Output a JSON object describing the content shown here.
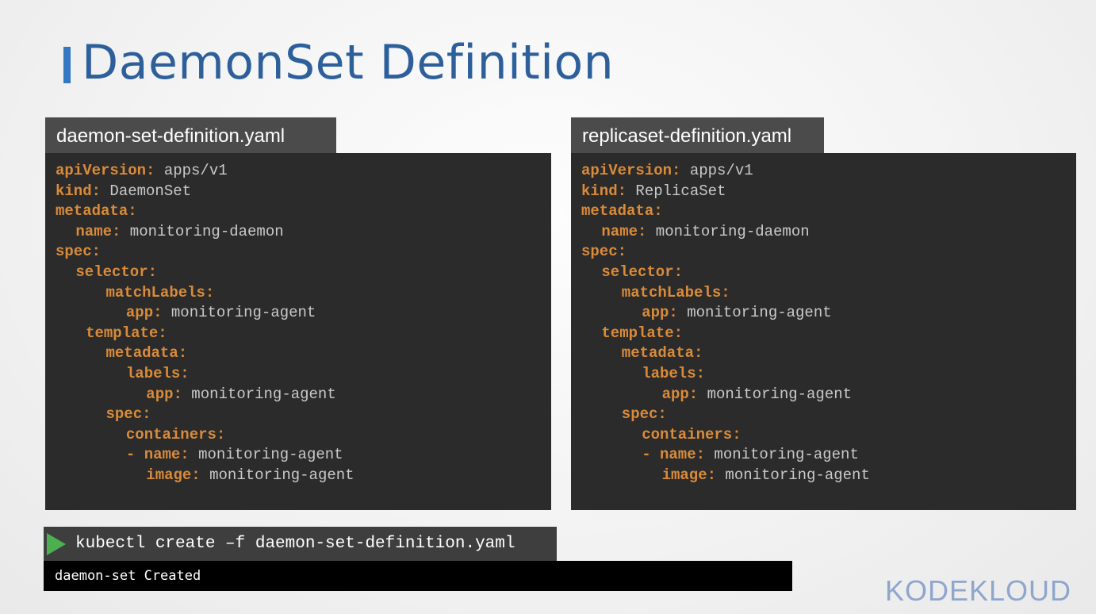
{
  "slide": {
    "title": "DaemonSet Definition"
  },
  "left_file": {
    "filename": "daemon-set-definition.yaml",
    "lines": [
      {
        "indent": 0,
        "key": "apiVersion:",
        "value": " apps/v1"
      },
      {
        "indent": 0,
        "key": "kind:",
        "value": " DaemonSet"
      },
      {
        "indent": 0,
        "key": "metadata:",
        "value": ""
      },
      {
        "indent": 2,
        "key": "name:",
        "value": " monitoring-daemon"
      },
      {
        "indent": 0,
        "key": "spec:",
        "value": ""
      },
      {
        "indent": 2,
        "key": "selector:",
        "value": ""
      },
      {
        "indent": 5,
        "key": "matchLabels:",
        "value": ""
      },
      {
        "indent": 7,
        "key": "app:",
        "value": " monitoring-agent"
      },
      {
        "indent": 3,
        "key": "template:",
        "value": ""
      },
      {
        "indent": 5,
        "key": "metadata:",
        "value": ""
      },
      {
        "indent": 7,
        "key": "labels:",
        "value": ""
      },
      {
        "indent": 9,
        "key": "app:",
        "value": " monitoring-agent"
      },
      {
        "indent": 5,
        "key": "spec:",
        "value": ""
      },
      {
        "indent": 7,
        "key": "containers:",
        "value": ""
      },
      {
        "indent": 7,
        "key": "- name:",
        "value": " monitoring-agent"
      },
      {
        "indent": 9,
        "key": "image:",
        "value": " monitoring-agent"
      }
    ]
  },
  "right_file": {
    "filename": "replicaset-definition.yaml",
    "lines": [
      {
        "indent": 0,
        "key": "apiVersion:",
        "value": " apps/v1"
      },
      {
        "indent": 0,
        "key": "kind:",
        "value": " ReplicaSet"
      },
      {
        "indent": 0,
        "key": "metadata:",
        "value": ""
      },
      {
        "indent": 2,
        "key": "name:",
        "value": " monitoring-daemon"
      },
      {
        "indent": 0,
        "key": "spec:",
        "value": ""
      },
      {
        "indent": 2,
        "key": "selector:",
        "value": ""
      },
      {
        "indent": 4,
        "key": "matchLabels:",
        "value": ""
      },
      {
        "indent": 6,
        "key": "app:",
        "value": " monitoring-agent"
      },
      {
        "indent": 2,
        "key": "template:",
        "value": ""
      },
      {
        "indent": 4,
        "key": "metadata:",
        "value": ""
      },
      {
        "indent": 6,
        "key": "labels:",
        "value": ""
      },
      {
        "indent": 8,
        "key": "app:",
        "value": " monitoring-agent"
      },
      {
        "indent": 4,
        "key": "spec:",
        "value": ""
      },
      {
        "indent": 6,
        "key": "containers:",
        "value": ""
      },
      {
        "indent": 6,
        "key": "- name:",
        "value": " monitoring-agent"
      },
      {
        "indent": 8,
        "key": "image:",
        "value": " monitoring-agent"
      }
    ]
  },
  "terminal": {
    "command": "kubectl create –f daemon-set-definition.yaml",
    "output": "daemon-set Created"
  },
  "brand": {
    "logo_text": "KODEKLOUD"
  },
  "colors": {
    "title": "#2d5f9b",
    "accent_bar": "#3478c0",
    "yaml_key": "#d98b3a",
    "yaml_value": "#c9c9c9",
    "play_icon": "#4caf50"
  }
}
